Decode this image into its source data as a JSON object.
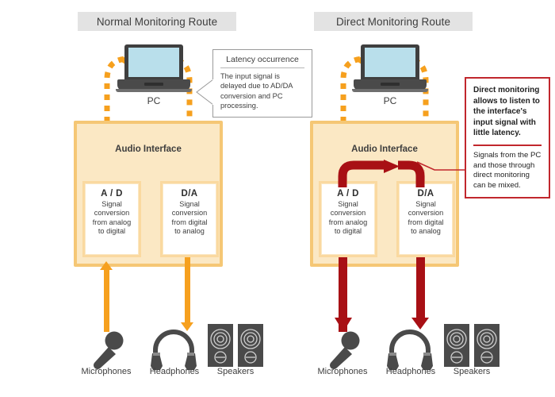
{
  "panels": [
    {
      "id": "normal",
      "title": "Normal Monitoring Route",
      "pc_label": "PC",
      "interface_label": "Audio Interface",
      "converters": [
        {
          "name": "A / D",
          "desc": "Signal\nconversion\nfrom analog\nto digital"
        },
        {
          "name": "D/A",
          "desc": "Signal\nconversion\nfrom digital\nto analog"
        }
      ],
      "devices": [
        {
          "icon": "microphone-icon",
          "label": "Microphones"
        },
        {
          "icon": "headphones-icon",
          "label": "Headphones"
        },
        {
          "icon": "speakers-icon",
          "label": "Speakers"
        }
      ]
    },
    {
      "id": "direct",
      "title": "Direct Monitoring Route",
      "pc_label": "PC",
      "interface_label": "Audio Interface",
      "converters": [
        {
          "name": "A / D",
          "desc": "Signal\nconversion\nfrom analog\nto digital"
        },
        {
          "name": "D/A",
          "desc": "Signal\nconversion\nfrom digital\nto analog"
        }
      ],
      "devices": [
        {
          "icon": "microphone-icon",
          "label": "Microphones"
        },
        {
          "icon": "headphones-icon",
          "label": "Headphones"
        },
        {
          "icon": "speakers-icon",
          "label": "Speakers"
        }
      ]
    }
  ],
  "callout_latency": {
    "title": "Latency occurrence",
    "body": "The input signal is delayed due to AD/DA conversion and PC processing."
  },
  "callout_direct": {
    "top": "Direct monitoring allows to listen to the interface's input signal with little latency.",
    "bottom": "Signals from the PC and those through direct monitoring can be mixed."
  },
  "colors": {
    "orange_arrow": "#f6a01e",
    "red_arrow": "#a81015",
    "interface_fill": "#fbe8c4",
    "interface_border": "#f5c775",
    "title_bar": "#e3e3e3",
    "callout_red_border": "#c1272d",
    "screen": "#b9dfeb",
    "device_gray": "#4a4a4a"
  }
}
